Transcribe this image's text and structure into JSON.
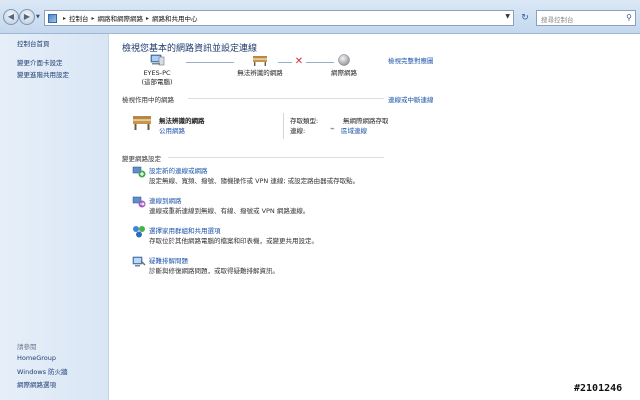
{
  "breadcrumb": [
    "控制台",
    "網路和網際網路",
    "網路和共用中心"
  ],
  "search": {
    "placeholder": "搜尋控制台"
  },
  "sidebar": {
    "items": [
      {
        "label": "控制台首頁"
      },
      {
        "label": "變更介面卡設定"
      },
      {
        "label": "變更進階共用設定"
      }
    ],
    "see_also_label": "請參閱",
    "see_also": [
      {
        "label": "HomeGroup"
      },
      {
        "label": "Windows 防火牆"
      },
      {
        "label": "網際網路選項"
      }
    ]
  },
  "main": {
    "title": "檢視您基本的網路資訊並設定連線",
    "view_full_map": "檢視完整對應圖",
    "map": {
      "computer_name": "EYES-PC",
      "computer_sub": "(這部電腦)",
      "network_label": "無法辨識的網路",
      "internet_label": "網際網路"
    },
    "active_networks_label": "檢視作用中的網路",
    "connect_disconnect": "連線或中斷連線",
    "network": {
      "name": "無法辨識的網路",
      "type": "公用網路",
      "access_type_label": "存取類型:",
      "access_type_value": "無網際網路存取",
      "connections_label": "連線:",
      "connections_value": "區域連線"
    },
    "change_settings_label": "變更網路設定",
    "tasks": [
      {
        "link": "設定新的連線或網路",
        "desc": "設定無線、寬頻、撥號、隨機操作或 VPN 連線; 或設定路由器或存取點。",
        "icon": "new-connection-icon"
      },
      {
        "link": "連線到網路",
        "desc": "連線或重新連線到無線、有線、撥號或 VPN 網路連線。",
        "icon": "connect-network-icon"
      },
      {
        "link": "選擇家用群組和共用選項",
        "desc": "存取位於其他網路電腦的檔案和印表機，或變更共用設定。",
        "icon": "homegroup-icon"
      },
      {
        "link": "疑難排解問題",
        "desc": "診斷與修復網路問題，或取得疑難排解資訊。",
        "icon": "troubleshoot-icon"
      }
    ]
  },
  "watermark": "#2101246"
}
